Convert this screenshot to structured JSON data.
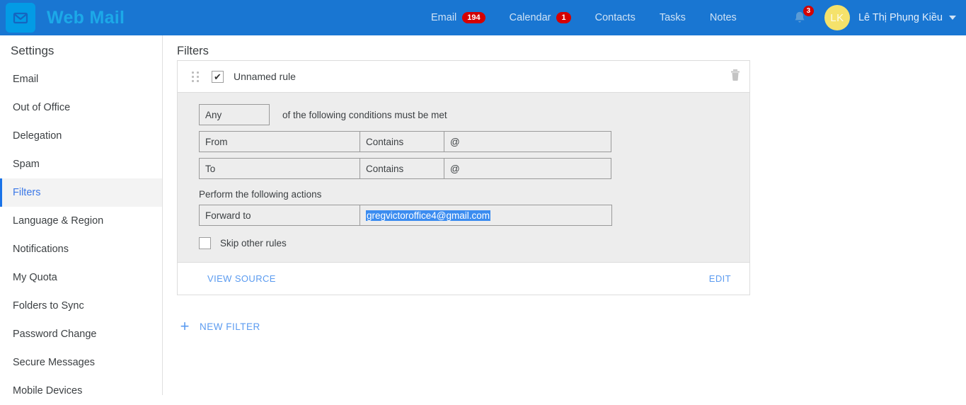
{
  "brand": {
    "name": "Web Mail",
    "logo_icon": "envelope-icon"
  },
  "nav": [
    {
      "label": "Email",
      "badge": "194"
    },
    {
      "label": "Calendar",
      "badge": "1"
    },
    {
      "label": "Contacts",
      "badge": null
    },
    {
      "label": "Tasks",
      "badge": null
    },
    {
      "label": "Notes",
      "badge": null
    }
  ],
  "header_right": {
    "bell_icon": "bell-icon",
    "bell_badge": "3",
    "avatar_initials": "LK",
    "user_name": "Lê Thị Phụng Kiều",
    "caret_icon": "chevron-down-icon"
  },
  "sidebar": {
    "title": "Settings",
    "items": [
      {
        "label": "Email",
        "active": false
      },
      {
        "label": "Out of Office",
        "active": false
      },
      {
        "label": "Delegation",
        "active": false
      },
      {
        "label": "Spam",
        "active": false
      },
      {
        "label": "Filters",
        "active": true
      },
      {
        "label": "Language & Region",
        "active": false
      },
      {
        "label": "Notifications",
        "active": false
      },
      {
        "label": "My Quota",
        "active": false
      },
      {
        "label": "Folders to Sync",
        "active": false
      },
      {
        "label": "Password Change",
        "active": false
      },
      {
        "label": "Secure Messages",
        "active": false
      },
      {
        "label": "Mobile Devices",
        "active": false
      }
    ]
  },
  "main": {
    "page_title": "Filters",
    "filter_card": {
      "drag_handle_icon": "drag-handle-icon",
      "enabled_checkbox_checked": true,
      "rule_name": "Unnamed rule",
      "delete_icon": "trash-icon",
      "match_select": "Any",
      "match_text": "of the following conditions must be met",
      "conditions": [
        {
          "field": "From",
          "operator": "Contains",
          "value": "@"
        },
        {
          "field": "To",
          "operator": "Contains",
          "value": "@"
        }
      ],
      "actions_label": "Perform the following actions",
      "actions": [
        {
          "field": "Forward to",
          "value": "gregvictoroffice4@gmail.com",
          "selected": true
        }
      ],
      "skip_other_rules": {
        "label": "Skip other rules",
        "checked": false
      },
      "view_source_label": "VIEW SOURCE",
      "edit_label": "EDIT"
    },
    "new_filter": {
      "label": "NEW FILTER",
      "icon": "plus-icon"
    }
  },
  "colors": {
    "header_blue": "#1976d2",
    "logo_blue": "#039be5",
    "brand_text": "#1ca9e8",
    "accent_link": "#5b9bf0",
    "active_item": "#3b78e7",
    "badge_red": "#d50000",
    "selection_blue": "#3b8cf0",
    "panel_gray": "#ededed",
    "avatar_yellow": "#f5e26b"
  }
}
